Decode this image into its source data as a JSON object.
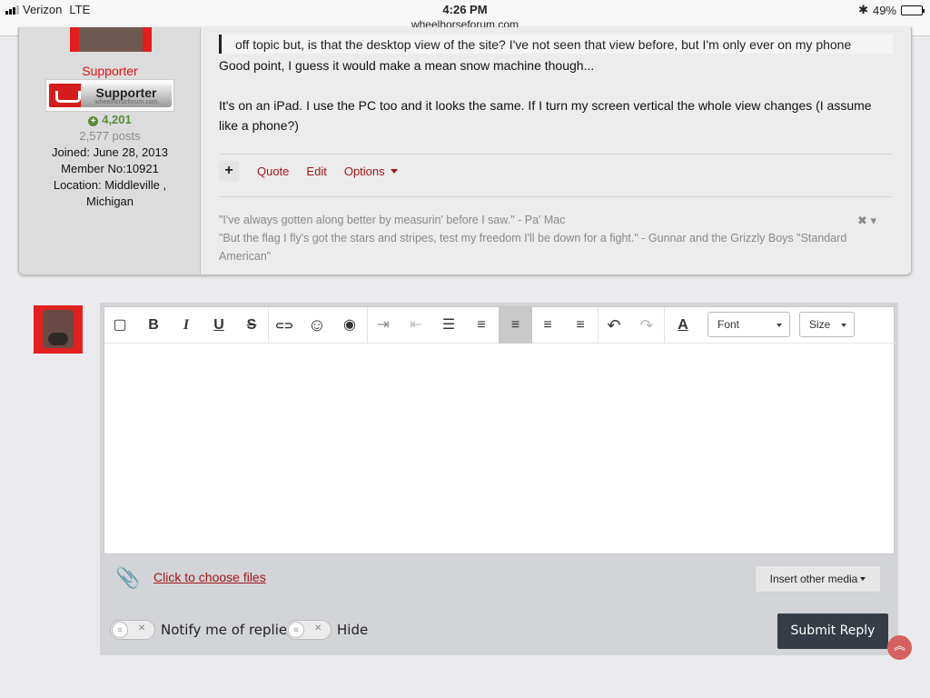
{
  "statusbar": {
    "carrier": "Verizon",
    "network": "LTE",
    "time": "4:26 PM",
    "url": "wheelhorseforum.com",
    "battery_percent": "49%",
    "battery_level": 0.49
  },
  "author": {
    "title": "Supporter",
    "badge_label": "Supporter",
    "badge_sub": "wheelhorseforum.com",
    "reputation": "4,201",
    "posts": "2,577 posts",
    "joined": "Joined: June 28, 2013",
    "member_no": "Member No:10921",
    "location_line1": "Location: Middleville ,",
    "location_line2": "Michigan"
  },
  "post": {
    "quote": "off topic but, is that the desktop view of the site? I've not seen that view before, but I'm only ever on my phone",
    "line1": "Good point, I guess it would make a mean snow machine though...",
    "line2": "It's on an iPad.  I use the PC too and it looks the same.  If I turn my screen vertical the whole view changes (I assume",
    "line3": "like a phone?)",
    "actions": {
      "plus": "+",
      "quote": "Quote",
      "edit": "Edit",
      "options": "Options"
    },
    "signature": {
      "line1": "\"I've always gotten along better by measurin' before I saw.\" - Pa' Mac",
      "line2": "\"But the flag I fly's got the stars and stripes, test my freedom I'll be down for a fight.\" - Gunnar and the Grizzly Boys \"Standard",
      "line3": "American\"",
      "close": "✖ ▾"
    }
  },
  "editor": {
    "toolbar": {
      "source": "▢",
      "bold": "B",
      "italic": "I",
      "underline": "U",
      "strike": "S",
      "link": "⊂⊃",
      "emoji": "☺",
      "preview": "◉",
      "indent": "⇥",
      "outdent": "⇤",
      "bullets": "☰",
      "numbers": "≡",
      "align_left": "≡",
      "align_center": "≡",
      "align_right": "≡",
      "undo": "↶",
      "redo": "↷",
      "color": "A",
      "font_label": "Font",
      "size_label": "Size"
    },
    "attach_link": "Click to choose files",
    "insert_media": "Insert other media",
    "notify_label": "Notify me of replies",
    "hide_label": "Hide",
    "submit": "Submit Reply"
  }
}
